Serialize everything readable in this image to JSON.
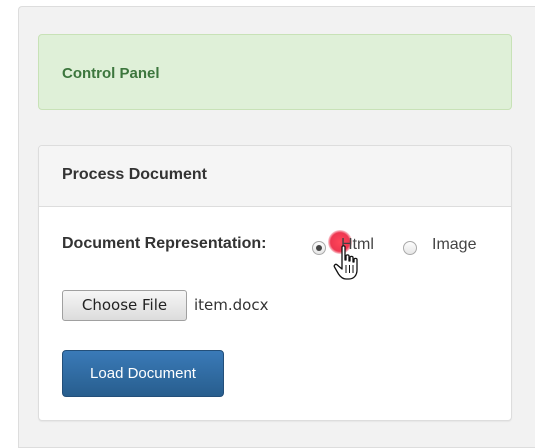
{
  "alert": {
    "title": "Control Panel",
    "color": "#3c763d",
    "background": "#dff0d8"
  },
  "panel": {
    "heading": "Process Document",
    "representation": {
      "label": "Document Representation:",
      "options": [
        {
          "label": "Html",
          "selected": true
        },
        {
          "label": "Image",
          "selected": false
        }
      ]
    },
    "file": {
      "button_label": "Choose File",
      "selected_file": "item.docx"
    },
    "load_button": {
      "label": "Load Document",
      "color": "#337ab7"
    }
  },
  "cursor": {
    "icon": "hand-pointer-icon"
  }
}
